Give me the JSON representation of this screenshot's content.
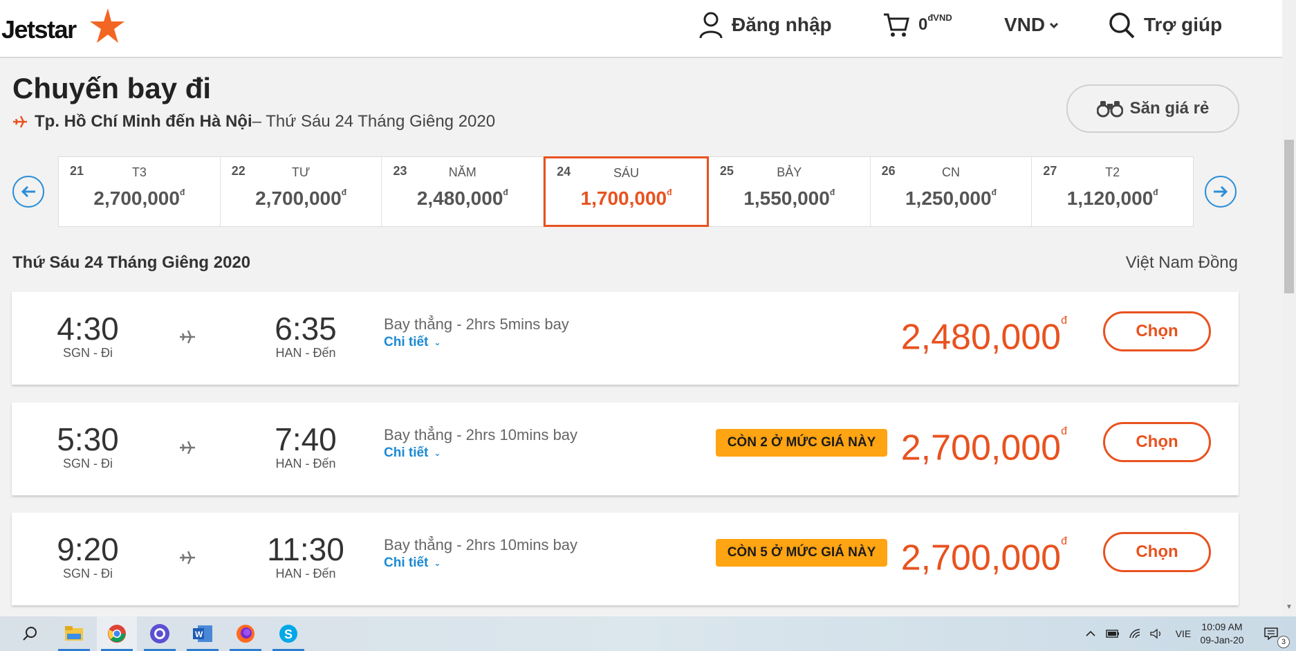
{
  "header": {
    "logo_text": "Jetstar",
    "login_label": "Đăng nhập",
    "cart_amount": "0",
    "cart_currency": "đVND",
    "currency_select": "VND",
    "help_label": "Trợ giúp",
    "brand_color": "#e8521f"
  },
  "search": {
    "title": "Chuyến bay đi",
    "route": "Tp. Hồ Chí Minh đến Hà Nội",
    "route_date": " – Thứ Sáu 24 Tháng Giêng 2020",
    "deal_button": "Săn giá rẻ"
  },
  "date_strip": [
    {
      "num": "21",
      "day": "T3",
      "price": "2,700,000",
      "sym": "đ"
    },
    {
      "num": "22",
      "day": "TƯ",
      "price": "2,700,000",
      "sym": "đ"
    },
    {
      "num": "23",
      "day": "NĂM",
      "price": "2,480,000",
      "sym": "đ"
    },
    {
      "num": "24",
      "day": "SÁU",
      "price": "1,700,000",
      "sym": "đ",
      "selected": true
    },
    {
      "num": "25",
      "day": "BẢY",
      "price": "1,550,000",
      "sym": "đ"
    },
    {
      "num": "26",
      "day": "CN",
      "price": "1,250,000",
      "sym": "đ"
    },
    {
      "num": "27",
      "day": "T2",
      "price": "1,120,000",
      "sym": "đ"
    }
  ],
  "list": {
    "date_heading": "Thứ Sáu 24 Tháng Giêng 2020",
    "currency_name": "Việt Nam Đồng"
  },
  "flights": [
    {
      "dep_time": "4:30",
      "dep_code": "SGN - Đi",
      "arr_time": "6:35",
      "arr_code": "HAN - Đến",
      "desc": "Bay thẳng - 2hrs 5mins bay",
      "detail": "Chi tiết",
      "badge": "",
      "price": "2,480,000",
      "sym": "đ",
      "select": "Chọn"
    },
    {
      "dep_time": "5:30",
      "dep_code": "SGN - Đi",
      "arr_time": "7:40",
      "arr_code": "HAN - Đến",
      "desc": "Bay thẳng - 2hrs 10mins bay",
      "detail": "Chi tiết",
      "badge": "CÒN 2 Ở MỨC GIÁ NÀY",
      "price": "2,700,000",
      "sym": "đ",
      "select": "Chọn"
    },
    {
      "dep_time": "9:20",
      "dep_code": "SGN - Đi",
      "arr_time": "11:30",
      "arr_code": "HAN - Đến",
      "desc": "Bay thẳng - 2hrs 10mins bay",
      "detail": "Chi tiết",
      "badge": "CÒN 5 Ở MỨC GIÁ NÀY",
      "price": "2,700,000",
      "sym": "đ",
      "select": "Chọn"
    }
  ],
  "taskbar": {
    "language": "VIE",
    "time": "10:09 AM",
    "date": "09-Jan-20",
    "notification_count": "3",
    "apps": [
      "search-icon",
      "file-explorer-icon",
      "chrome-icon",
      "github-desktop-icon",
      "word-icon",
      "firefox-icon",
      "skype-icon"
    ]
  }
}
